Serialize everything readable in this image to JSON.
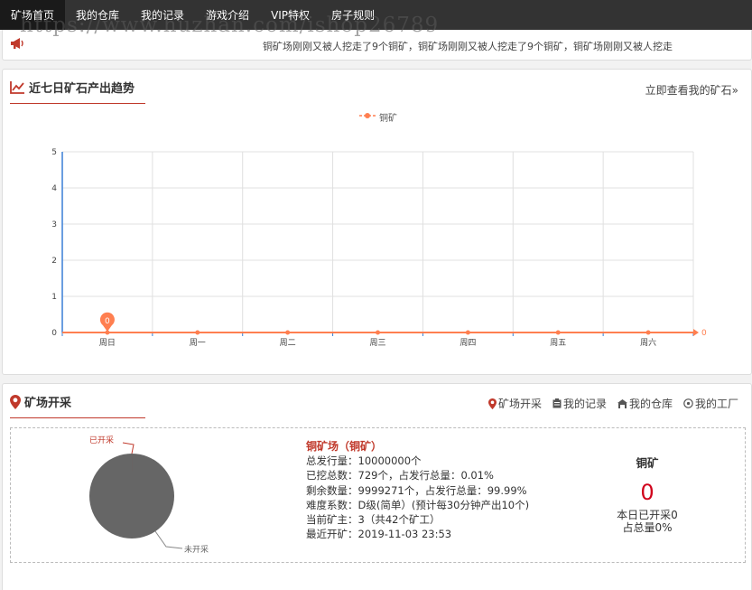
{
  "nav": {
    "items": [
      {
        "label": "矿场首页",
        "active": true
      },
      {
        "label": "我的仓库",
        "active": false
      },
      {
        "label": "我的记录",
        "active": false
      },
      {
        "label": "游戏介绍",
        "active": false
      },
      {
        "label": "VIP特权",
        "active": false
      },
      {
        "label": "房子规则",
        "active": false
      }
    ]
  },
  "watermark": "https://www.huzhan.com/ishop26789",
  "notice": {
    "icon": "megaphone-icon",
    "text": "铜矿场刚刚又被人挖走了9个铜矿，铜矿场刚刚又被人挖走了9个铜矿，铜矿场刚刚又被人挖走"
  },
  "trend": {
    "title": "近七日矿石产出趋势",
    "more_link": "立即查看我的矿石»",
    "accent": "#c0392b"
  },
  "chart_data": {
    "type": "line",
    "categories": [
      "周日",
      "周一",
      "周二",
      "周三",
      "周四",
      "周五",
      "周六"
    ],
    "series": [
      {
        "name": "铜矿",
        "values": [
          0,
          0,
          0,
          0,
          0,
          0,
          0
        ],
        "color": "#ff7f50"
      }
    ],
    "ylim": [
      0,
      5
    ],
    "yticks": [
      0,
      1,
      2,
      3,
      4,
      5
    ],
    "legend": "top-center",
    "grid": true,
    "markpoint": {
      "label": "0",
      "category": "周日",
      "value": 0
    },
    "endlabel": "0"
  },
  "mine": {
    "title": "矿场开采",
    "links": [
      {
        "label": "矿场开采",
        "icon": "map-pin-icon"
      },
      {
        "label": "我的记录",
        "icon": "clipboard-icon"
      },
      {
        "label": "我的仓库",
        "icon": "warehouse-icon"
      },
      {
        "label": "我的工厂",
        "icon": "factory-icon"
      }
    ],
    "pie": {
      "slices": [
        {
          "label": "已开采",
          "value": 0.01,
          "color": "#c0392b"
        },
        {
          "label": "未开采",
          "value": 99.99,
          "color": "#666666"
        }
      ]
    },
    "info": {
      "name": "铜矿场（铜矿）",
      "lines": [
        "总发行量：10000000个",
        "已挖总数：729个，占发行总量：0.01%",
        "剩余数量：9999271个，占发行总量：99.99%",
        "难度系数：D级(简单）(预计每30分钟产出10个)",
        "当前矿主：3（共42个矿工）",
        "最近开矿：2019-11-03 23:53"
      ]
    },
    "today": {
      "ore": "铜矿",
      "count": "0",
      "line1": "本日已开采0",
      "line2": "占总量0%"
    }
  }
}
